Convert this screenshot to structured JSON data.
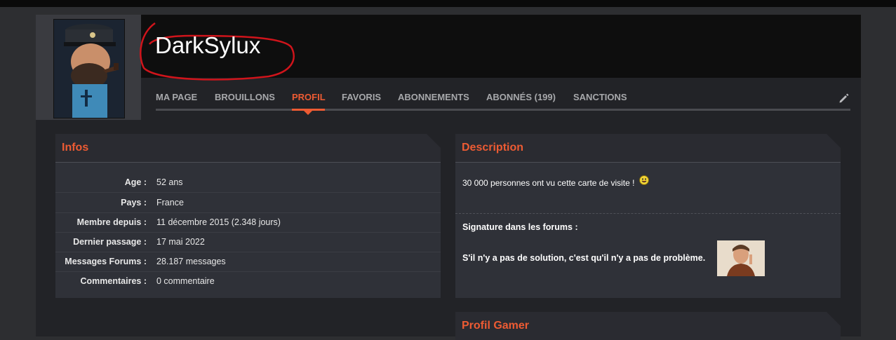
{
  "profile": {
    "username": "DarkSylux"
  },
  "tabs": [
    {
      "label": "MA PAGE"
    },
    {
      "label": "BROUILLONS"
    },
    {
      "label": "PROFIL"
    },
    {
      "label": "FAVORIS"
    },
    {
      "label": "ABONNEMENTS"
    },
    {
      "label": "ABONNÉS (199)"
    },
    {
      "label": "SANCTIONS"
    }
  ],
  "active_tab": "PROFIL",
  "infos": {
    "title": "Infos",
    "rows": [
      {
        "label": "Age :",
        "value": "52 ans"
      },
      {
        "label": "Pays :",
        "value": "France"
      },
      {
        "label": "Membre depuis :",
        "value": "11 décembre 2015 (2.348 jours)"
      },
      {
        "label": "Dernier passage :",
        "value": "17 mai 2022"
      },
      {
        "label": "Messages Forums :",
        "value": "28.187 messages"
      },
      {
        "label": "Commentaires :",
        "value": "0 commentaire"
      }
    ]
  },
  "description": {
    "title": "Description",
    "text": "30 000 personnes ont vu cette carte de visite !",
    "signature_label": "Signature dans les forums :",
    "signature_text": "S'il n'y a pas de solution, c'est qu'il n'y a pas de problème."
  },
  "profil_gamer": {
    "title": "Profil Gamer"
  },
  "colors": {
    "accent": "#ed5b33",
    "annotation_circle": "#d0141b"
  },
  "icons": {
    "edit": "pencil-icon",
    "smiley": "smiley-icon"
  }
}
